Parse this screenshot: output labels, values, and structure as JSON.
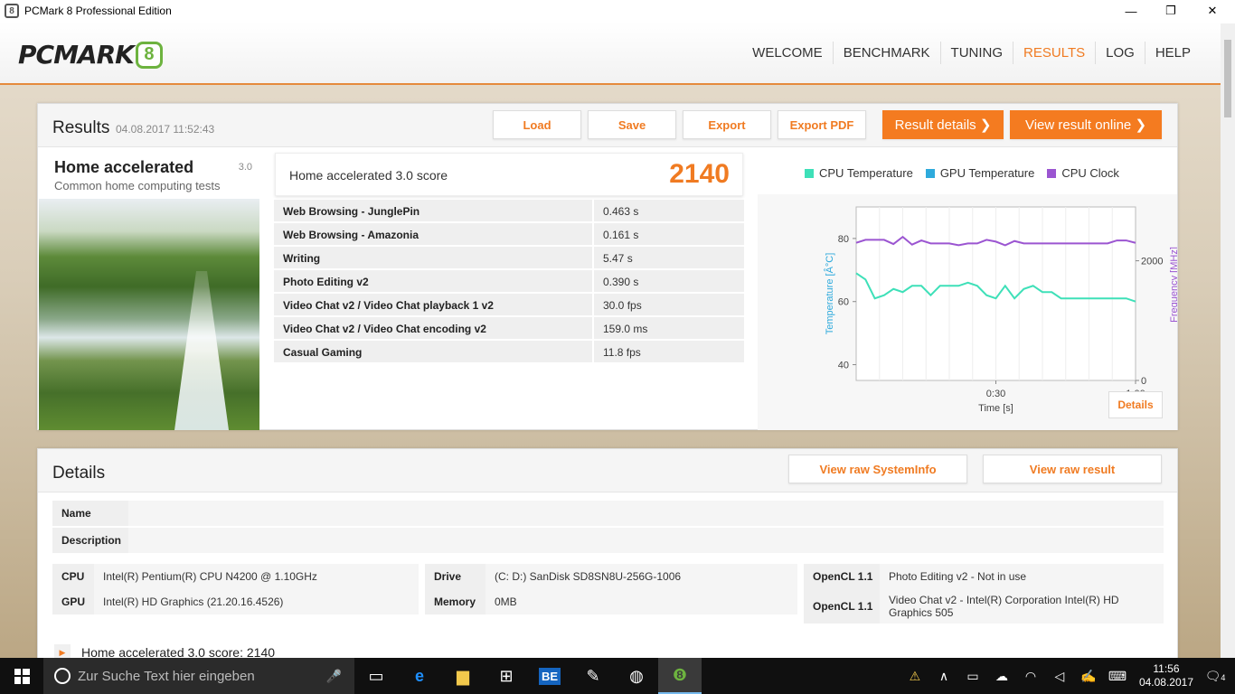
{
  "window": {
    "title": "PCMark 8 Professional Edition",
    "minimize": "—",
    "maximize": "❐",
    "close": "✕"
  },
  "logo": {
    "text": "PCMARK",
    "number": "8"
  },
  "nav": [
    {
      "label": "WELCOME",
      "active": false
    },
    {
      "label": "BENCHMARK",
      "active": false
    },
    {
      "label": "TUNING",
      "active": false
    },
    {
      "label": "RESULTS",
      "active": true
    },
    {
      "label": "LOG",
      "active": false
    },
    {
      "label": "HELP",
      "active": false
    }
  ],
  "results": {
    "title": "Results",
    "date": "04.08.2017 11:52:43",
    "buttons": {
      "load": "Load",
      "save": "Save",
      "export": "Export",
      "export_pdf": "Export PDF",
      "result_details": "Result details ❯",
      "view_online": "View result online ❯"
    },
    "test": {
      "name": "Home accelerated",
      "version": "3.0",
      "subtitle": "Common home computing tests"
    },
    "score": {
      "label": "Home accelerated 3.0 score",
      "value": "2140"
    },
    "rows": [
      {
        "name": "Web Browsing - JunglePin",
        "value": "0.463 s"
      },
      {
        "name": "Web Browsing - Amazonia",
        "value": "0.161 s"
      },
      {
        "name": "Writing",
        "value": "5.47 s"
      },
      {
        "name": "Photo Editing v2",
        "value": "0.390 s"
      },
      {
        "name": "Video Chat v2 / Video Chat playback 1 v2",
        "value": "30.0 fps"
      },
      {
        "name": "Video Chat v2 / Video Chat encoding v2",
        "value": "159.0 ms"
      },
      {
        "name": "Casual Gaming",
        "value": "11.8 fps"
      }
    ],
    "details_button": "Details"
  },
  "chart_data": {
    "type": "line",
    "xlabel": "Time [s]",
    "ylabel": "Temperature [Â°C]",
    "y2label": "Frequency [MHz]",
    "xticks": [
      "0:30",
      "1:00"
    ],
    "xlim": [
      0,
      60
    ],
    "ylim": [
      35,
      90
    ],
    "yticks": [
      40,
      60,
      80
    ],
    "y2lim": [
      0,
      2900
    ],
    "y2ticks": [
      0,
      2000
    ],
    "grid": true,
    "legend_position": "top",
    "x": [
      0,
      2,
      4,
      6,
      8,
      10,
      12,
      14,
      16,
      18,
      20,
      22,
      24,
      26,
      28,
      30,
      32,
      34,
      36,
      38,
      40,
      42,
      44,
      46,
      48,
      50,
      52,
      54,
      56,
      58,
      60
    ],
    "series": [
      {
        "name": "CPU Temperature",
        "color": "#3ee0b8",
        "axis": "left",
        "values": [
          69,
          67,
          61,
          62,
          64,
          63,
          65,
          65,
          62,
          65,
          65,
          65,
          66,
          65,
          62,
          61,
          65,
          61,
          64,
          65,
          63,
          63,
          61,
          61,
          61,
          61,
          61,
          61,
          61,
          61,
          60
        ]
      },
      {
        "name": "GPU Temperature",
        "color": "#2eaadc",
        "axis": "left",
        "values": []
      },
      {
        "name": "CPU Clock",
        "color": "#9b55d1",
        "axis": "right",
        "values": [
          2300,
          2350,
          2350,
          2350,
          2280,
          2400,
          2270,
          2340,
          2290,
          2290,
          2290,
          2260,
          2290,
          2290,
          2350,
          2320,
          2260,
          2330,
          2290,
          2290,
          2290,
          2290,
          2290,
          2290,
          2290,
          2290,
          2290,
          2290,
          2340,
          2340,
          2300
        ]
      }
    ]
  },
  "details": {
    "title": "Details",
    "view_systeminfo": "View raw SystemInfo",
    "view_raw_result": "View raw result",
    "name_label": "Name",
    "description_label": "Description",
    "cpu_label": "CPU",
    "cpu_value": "Intel(R) Pentium(R) CPU N4200 @ 1.10GHz",
    "gpu_label": "GPU",
    "gpu_value": "Intel(R) HD Graphics (21.20.16.4526)",
    "drive_label": "Drive",
    "drive_value": "(C: D:) SanDisk SD8SN8U-256G-1006",
    "memory_label": "Memory",
    "memory_value": "0MB",
    "opencl1_label": "OpenCL 1.1",
    "opencl1_value": "Photo Editing v2 - Not in use",
    "opencl2_label": "OpenCL 1.1",
    "opencl2_value": "Video Chat v2 - Intel(R) Corporation Intel(R) HD Graphics 505",
    "footer_item": "Home accelerated 3.0 score: 2140"
  },
  "taskbar": {
    "search_placeholder": "Zur Suche Text hier eingeben",
    "time": "11:56",
    "date": "04.08.2017",
    "notifications": "4"
  }
}
